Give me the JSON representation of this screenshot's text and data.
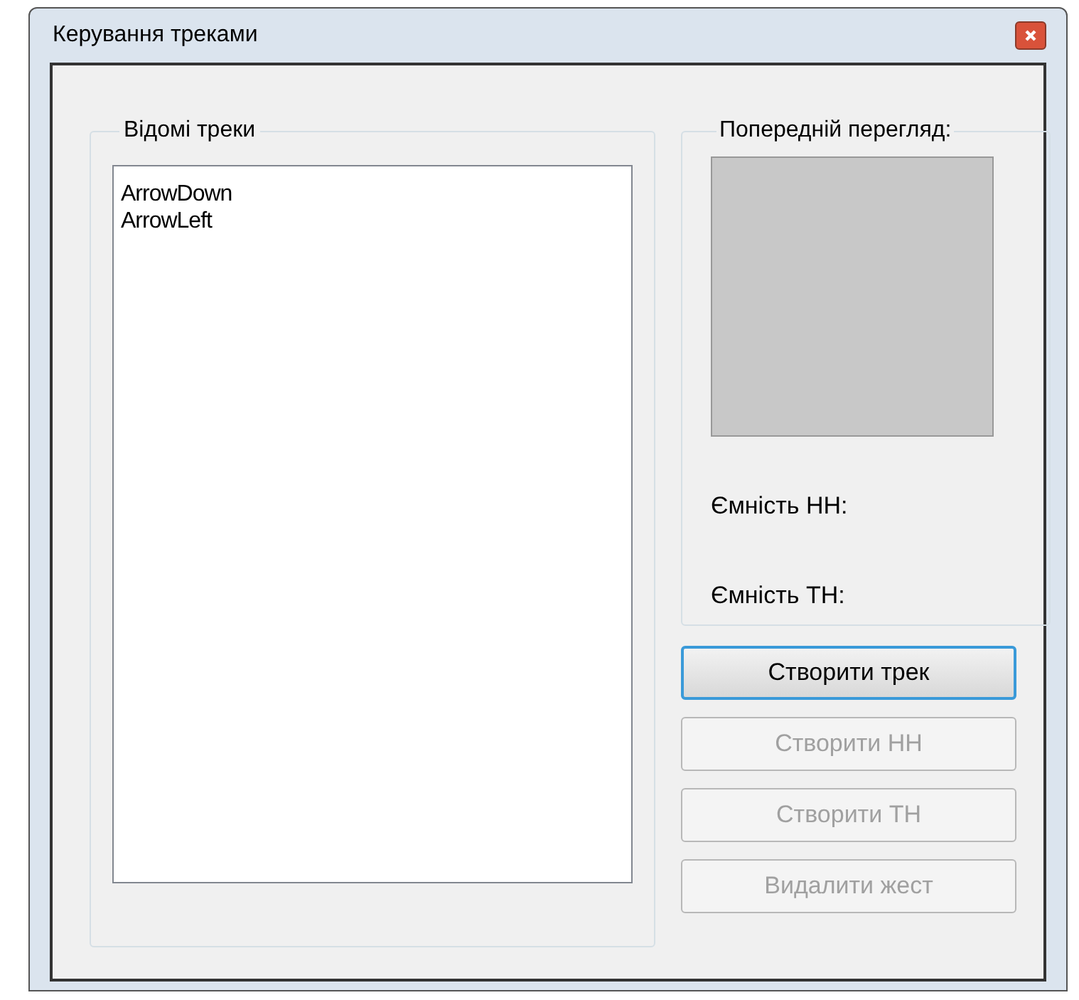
{
  "window": {
    "title": "Керування треками"
  },
  "known_tracks": {
    "label": "Відомі треки",
    "items": [
      "ArrowDown",
      "ArrowLeft"
    ]
  },
  "preview": {
    "label": "Попередній перегляд:",
    "fields": [
      "Ємність НН:",
      "Ємність ТН:"
    ]
  },
  "buttons": [
    {
      "label": "Створити трек",
      "disabled": false,
      "focused": true
    },
    {
      "label": "Створити НН",
      "disabled": true,
      "focused": false
    },
    {
      "label": "Створити ТН",
      "disabled": true,
      "focused": false
    },
    {
      "label": "Видалити жест",
      "disabled": true,
      "focused": false
    }
  ]
}
